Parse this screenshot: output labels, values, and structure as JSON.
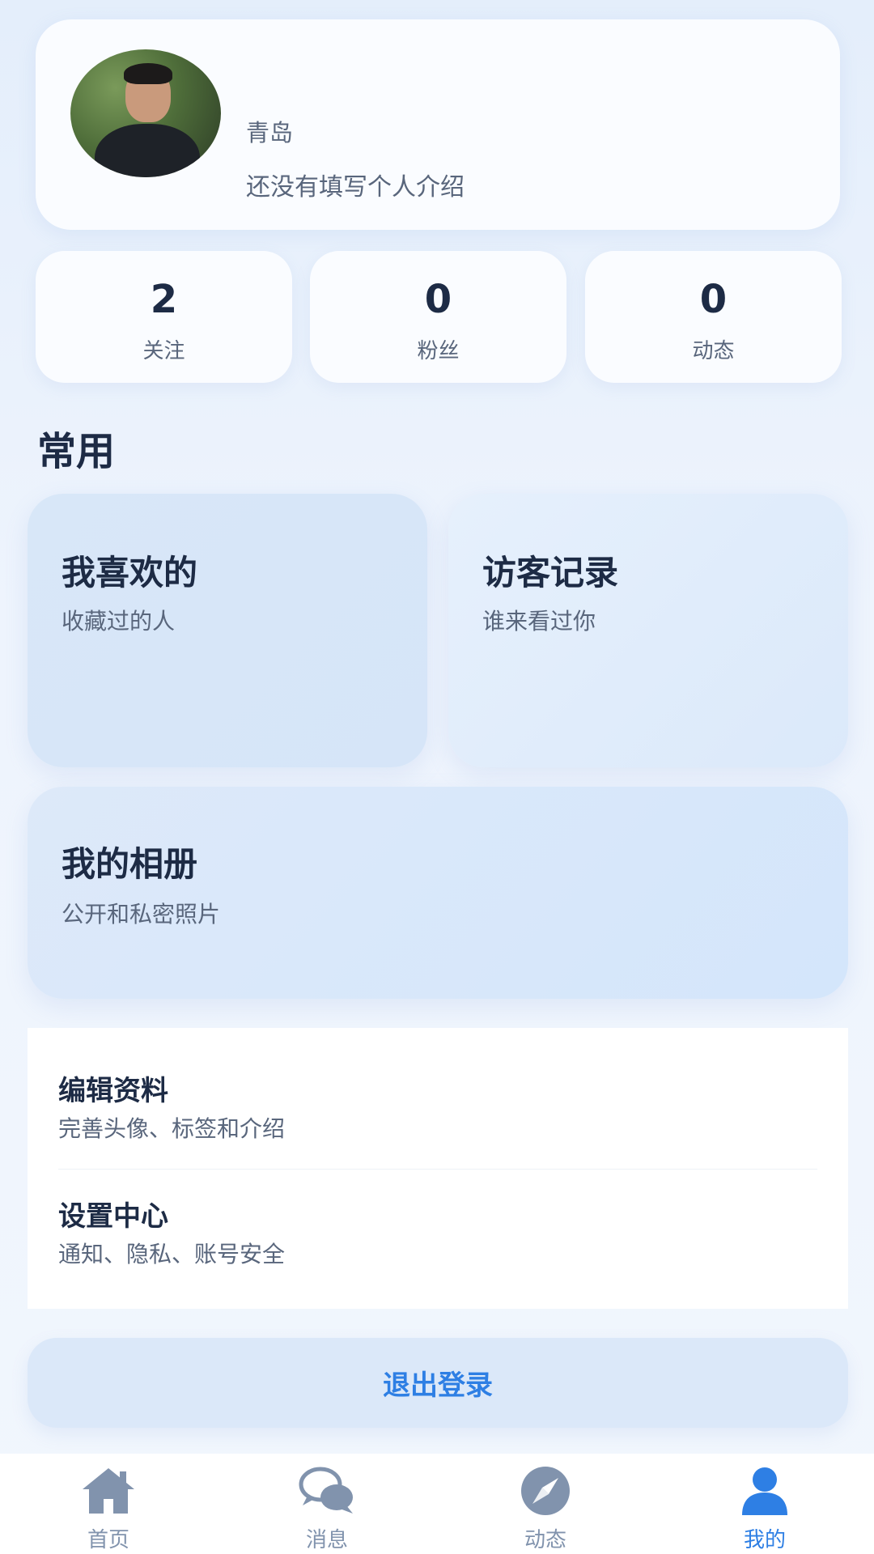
{
  "profile": {
    "location": "青岛",
    "intro": "还没有填写个人介绍"
  },
  "stats": [
    {
      "value": "2",
      "label": "关注"
    },
    {
      "value": "0",
      "label": "粉丝"
    },
    {
      "value": "0",
      "label": "动态"
    }
  ],
  "section_title": "常用",
  "features": {
    "liked": {
      "title": "我喜欢的",
      "subtitle": "收藏过的人"
    },
    "visitors": {
      "title": "访客记录",
      "subtitle": "谁来看过你"
    },
    "album": {
      "title": "我的相册",
      "subtitle": "公开和私密照片"
    }
  },
  "menu": [
    {
      "title": "编辑资料",
      "subtitle": "完善头像、标签和介绍"
    },
    {
      "title": "设置中心",
      "subtitle": "通知、隐私、账号安全"
    }
  ],
  "logout_label": "退出登录",
  "tabbar": {
    "items": [
      {
        "label": "首页",
        "icon": "home-icon"
      },
      {
        "label": "消息",
        "icon": "chat-bubbles-icon"
      },
      {
        "label": "动态",
        "icon": "compass-icon"
      },
      {
        "label": "我的",
        "icon": "user-icon"
      }
    ],
    "active": "我的"
  },
  "colors": {
    "accent": "#2e7fe4",
    "text_primary": "#1d2b45",
    "text_secondary": "#59667c",
    "tab_inactive": "#8193ad",
    "background": "#eaf1fb"
  }
}
